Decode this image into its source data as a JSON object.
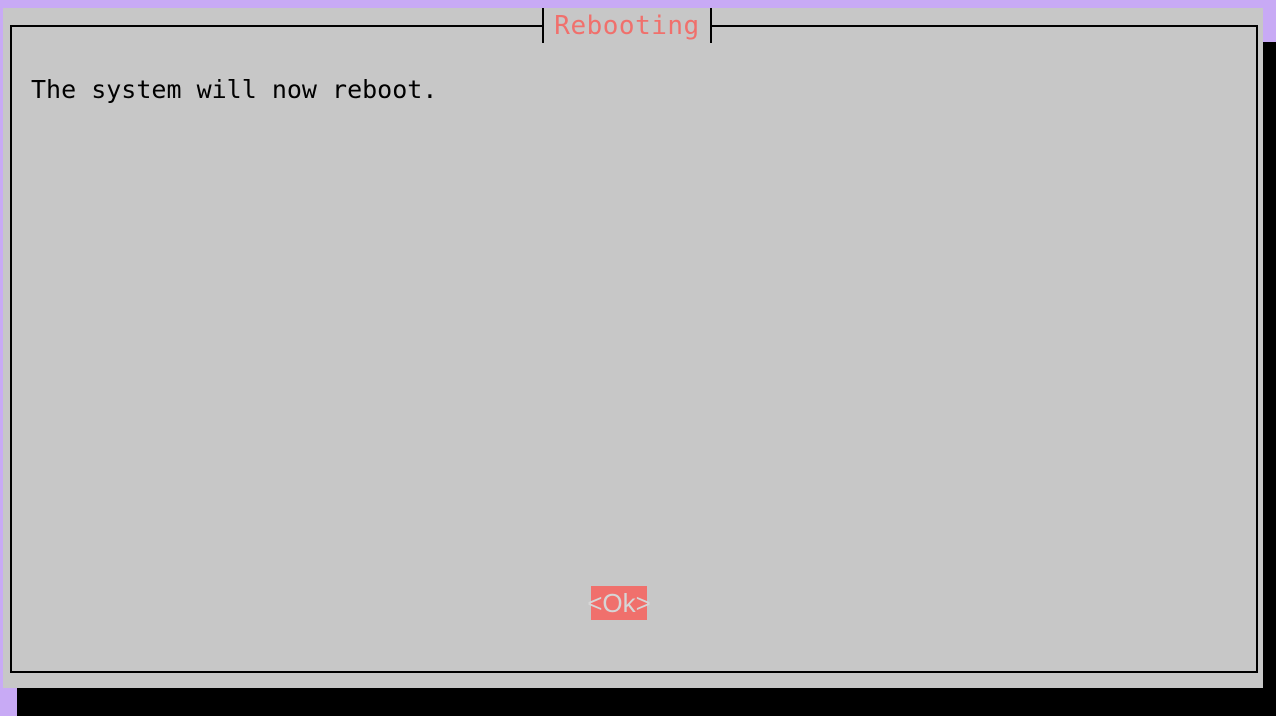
{
  "dialog": {
    "title": "Rebooting",
    "message": "The system will now reboot.",
    "ok_label": "<Ok>"
  },
  "colors": {
    "background": "#c8aaf5",
    "dialog": "#c7c7c7",
    "accent": "#f0706c",
    "shadow": "#000000"
  }
}
